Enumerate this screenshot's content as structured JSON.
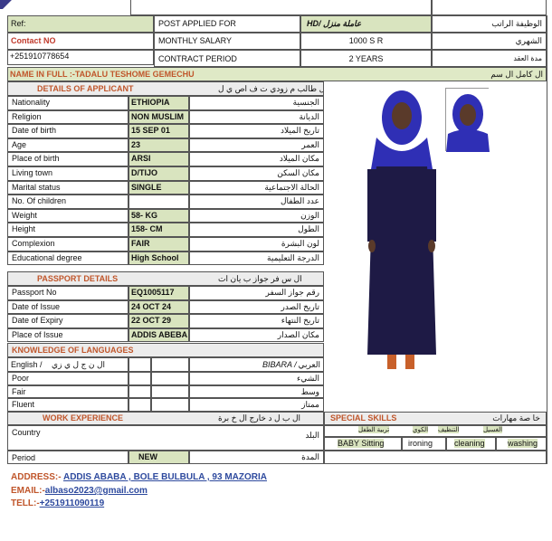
{
  "header": {
    "ref_label": "Ref:",
    "contact_label": "Contact NO",
    "contact_value": "+251910778654",
    "post_applied_label": "POST APPLIED FOR",
    "post_applied_value": "HD/ عاملة منزل",
    "post_applied_ar": "الوظيفة الراتب",
    "monthly_salary_label": "MONTHLY SALARY",
    "monthly_salary_value": "1000 S R",
    "monthly_salary_ar": "الشهري",
    "contract_period_label": "CONTRACT PERIOD",
    "contract_period_value": "2 YEARS",
    "contract_period_ar": "مدة العقد"
  },
  "name_row": {
    "label": "NAME IN FULL :-TADALU TESHOME GEMECHU",
    "ar": "ال كامل ال سم"
  },
  "applicant": {
    "title": "DETAILS OF APPLICANT",
    "title_ar": "ال طالب م زودي ت ف اص ي ل",
    "rows": [
      {
        "label": "Nationality",
        "value": "ETHIOPIA",
        "ar": "الجنسية"
      },
      {
        "label": "Religion",
        "value": "NON MUSLIM",
        "ar": "الديانة"
      },
      {
        "label": "Date of birth",
        "value": "15 SEP 01",
        "ar": "تاريخ الميلاد"
      },
      {
        "label": "Age",
        "value": "23",
        "ar": "العمر"
      },
      {
        "label": "Place of birth",
        "value": "ARSI",
        "ar": "مكان الميلاد"
      },
      {
        "label": "Living town",
        "value": "D/TIJO",
        "ar": "مكان السكن"
      },
      {
        "label": "Marital status",
        "value": "SINGLE",
        "ar": "الحالة الاجتماعية"
      },
      {
        "label": "No. Of children",
        "value": "",
        "ar": "عدد الطفال"
      },
      {
        "label": "Weight",
        "value": "58- KG",
        "ar": "الوزن"
      },
      {
        "label": "Height",
        "value": "158- CM",
        "ar": "الطول"
      },
      {
        "label": "Complexion",
        "value": "FAIR",
        "ar": "لون البشرة"
      },
      {
        "label": "Educational degree",
        "value": "High School",
        "ar": "الدرجة التعليمية"
      }
    ]
  },
  "passport": {
    "title": "PASSPORT DETAILS",
    "title_ar": "ال س فر جواز ب يان ات",
    "rows": [
      {
        "label": "Passport No",
        "value": "EQ1005117",
        "ar": "رقم جواز السفر"
      },
      {
        "label": "Date of Issue",
        "value": "24 OCT 24",
        "ar": "تاريخ الصدر"
      },
      {
        "label": "Date of Expiry",
        "value": "22 OCT 29",
        "ar": "تاريخ النتهاء"
      },
      {
        "label": "Place of Issue",
        "value": "ADDIS ABEBA",
        "ar": "مكان الصدار"
      }
    ]
  },
  "languages": {
    "title": "KNOWLEDGE OF LANGUAGES",
    "english_label": "English /",
    "english_ar": "ال ن ج ل ي زي",
    "arabic_label": "BIBARA /",
    "arabic_ar": "العربي",
    "rows": [
      {
        "label": "Poor",
        "ar": "الشيء"
      },
      {
        "label": "Fair",
        "ar": "وسط"
      },
      {
        "label": "Fluent",
        "ar": "ممتاز"
      }
    ]
  },
  "work": {
    "title": "WORK EXPERIENCE",
    "title_ar": "ال ب ل د خارج ال خ برة",
    "country_label": "Country",
    "country_ar": "البلد",
    "period_label": "Period",
    "period_value": "NEW",
    "period_ar": "المدة"
  },
  "skills": {
    "title": "SPECIAL SKILLS",
    "title_ar": "خا صة مهارات",
    "sub": [
      "تربية الطفل",
      "الكوي",
      "التنظيف",
      "الغسيل"
    ],
    "items": [
      {
        "label": "BABY Sitting"
      },
      {
        "label": "ironing"
      },
      {
        "label": "cleaning"
      },
      {
        "label": "washing"
      }
    ]
  },
  "footer": {
    "address_label": "ADDRESS:-",
    "address_value": "ADDIS ABABA , BOLE BULBULA , 93 MAZORIA",
    "email_label": "EMAIL:-",
    "email_value": "albaso2023@gmail.com",
    "tell_label": "TELL:-",
    "tell_value": "+251911090119"
  },
  "colors": {
    "green_fill": "#d9e4bf",
    "orange_text": "#c0562b",
    "red_text": "#c0392b",
    "link_blue": "#2e4a9e",
    "hijab_blue": "#2f2fb5",
    "dress_navy": "#1e1a45"
  }
}
